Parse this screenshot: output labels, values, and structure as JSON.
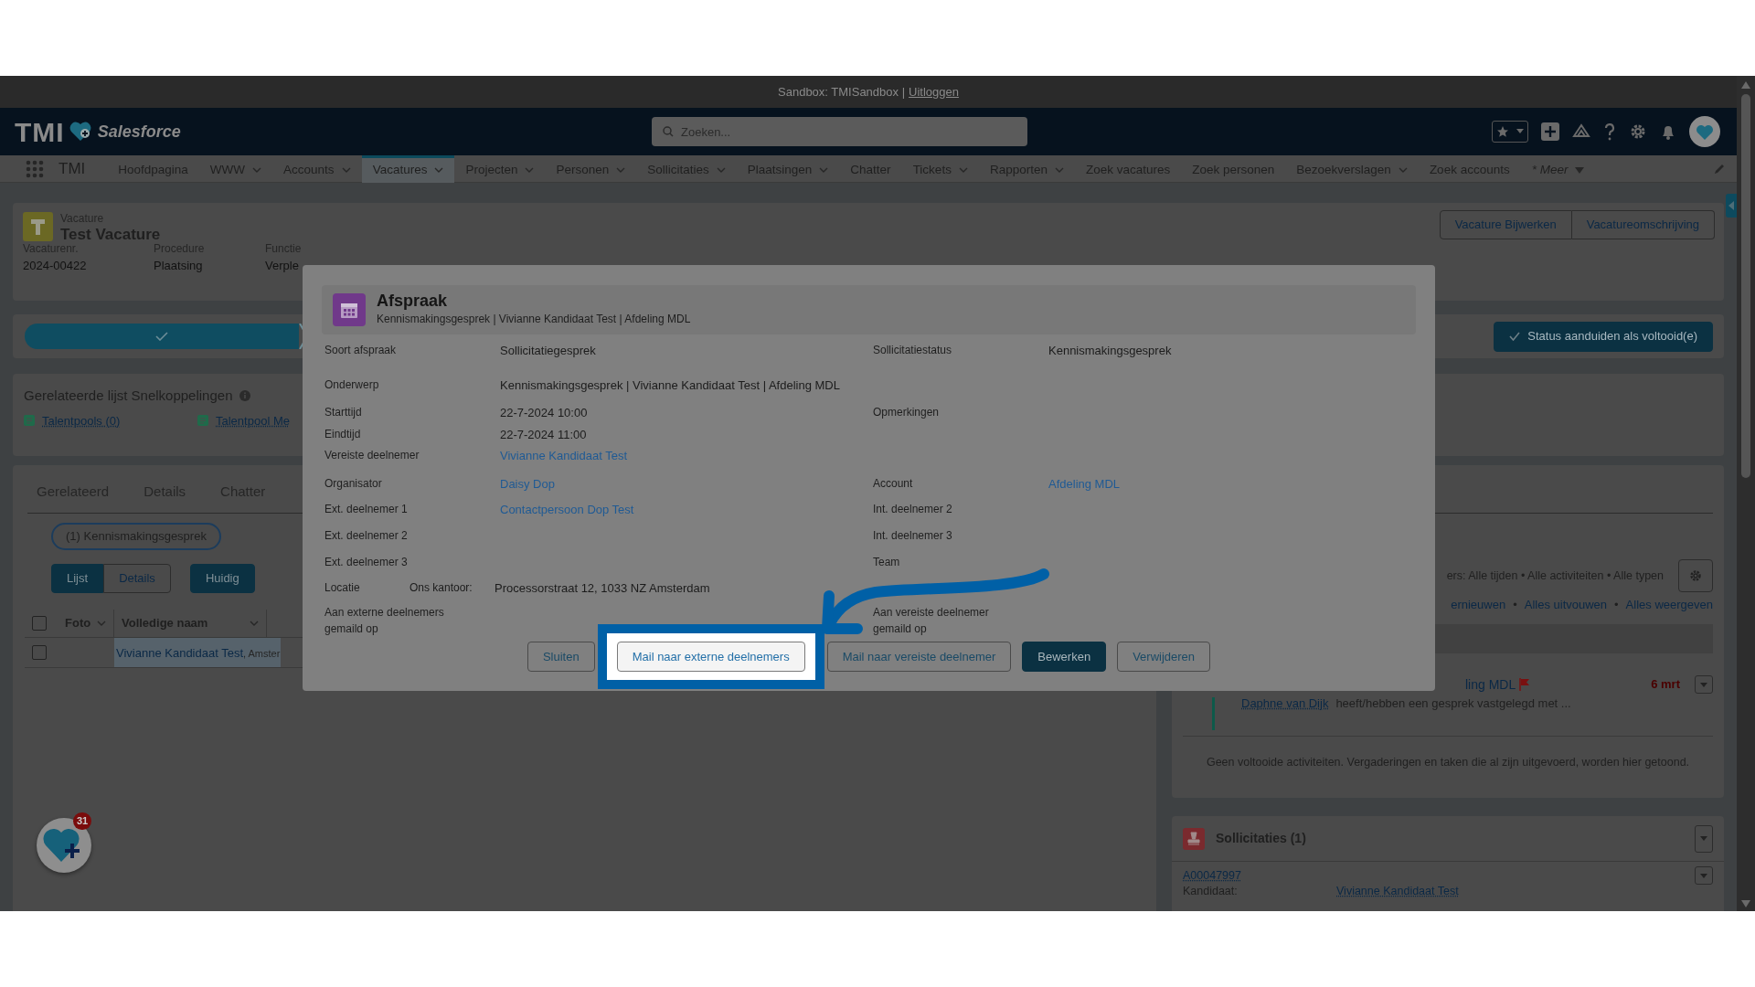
{
  "sandbox_bar": {
    "text": "Sandbox: TMISandbox |",
    "link": "Uitloggen"
  },
  "header": {
    "logo": "TMI",
    "brand": "Salesforce",
    "search": {
      "placeholder": "Zoeken..."
    }
  },
  "nav": {
    "app_name": "TMI",
    "items": [
      {
        "label": "Hoofdpagina",
        "kind": "plain",
        "selected": false
      },
      {
        "label": "WWW",
        "kind": "menu",
        "selected": false
      },
      {
        "label": "Accounts",
        "kind": "menu",
        "selected": false
      },
      {
        "label": "Vacatures",
        "kind": "menu",
        "selected": true
      },
      {
        "label": "Projecten",
        "kind": "menu",
        "selected": false
      },
      {
        "label": "Personen",
        "kind": "menu",
        "selected": false
      },
      {
        "label": "Sollicitaties",
        "kind": "menu",
        "selected": false
      },
      {
        "label": "Plaatsingen",
        "kind": "menu",
        "selected": false
      },
      {
        "label": "Chatter",
        "kind": "plain",
        "selected": false
      },
      {
        "label": "Tickets",
        "kind": "menu",
        "selected": false
      },
      {
        "label": "Rapporten",
        "kind": "menu",
        "selected": false
      },
      {
        "label": "Zoek vacatures",
        "kind": "plain",
        "selected": false
      },
      {
        "label": "Zoek personen",
        "kind": "plain",
        "selected": false
      },
      {
        "label": "Bezoekverslagen",
        "kind": "menu",
        "selected": false
      },
      {
        "label": "Zoek accounts",
        "kind": "plain",
        "selected": false
      },
      {
        "label": "* Meer",
        "kind": "more",
        "selected": false
      }
    ]
  },
  "record": {
    "object": "Vacature",
    "title": "Test Vacature",
    "fields": [
      {
        "label": "Vacaturenr.",
        "value": "2024-00422"
      },
      {
        "label": "Procedure",
        "value": "Plaatsing"
      },
      {
        "label": "Functie",
        "value": "Verple"
      }
    ],
    "actions": [
      "Vacature Bijwerken",
      "Vacatureomschrijving"
    ]
  },
  "path": {
    "action": "Status aanduiden als voltooid(e)"
  },
  "quick_links": {
    "title": "Gerelateerde lijst Snelkoppelingen",
    "links": [
      "Talentpools (0)",
      "Talentpool Me"
    ]
  },
  "tabs": [
    {
      "label": "Gerelateerd",
      "selected": false
    },
    {
      "label": "Details",
      "selected": false
    },
    {
      "label": "Chatter",
      "selected": false
    }
  ],
  "related": {
    "filter": "(1) Kennismakingsgesprek",
    "views": [
      {
        "label": "Lijst",
        "selected": true
      },
      {
        "label": "Details",
        "selected": false
      }
    ],
    "current": "Huidig",
    "select_all": false,
    "columns": [
      "Foto",
      "Volledige naam"
    ],
    "rows": [
      {
        "checked": false,
        "name": "Vivianne Kandidaat Test",
        "extra": ", Amster"
      }
    ]
  },
  "activity": {
    "filters": "ers: Alle tijden • Alle activiteiten • Alle typen",
    "links": [
      "ernieuwen",
      "Alles uitvouwen",
      "Alles weergeven"
    ],
    "separators": [
      "•",
      "•"
    ],
    "items": [
      {
        "subject": "ling MDL",
        "date": "6 mrt",
        "actor": "Daphne van Dijk",
        "text": "heeft/hebben een gesprek vastgelegd met ..."
      }
    ],
    "empty": "Geen voltooide activiteiten. Vergaderingen en taken die al zijn uitgevoerd, worden hier getoond."
  },
  "applications": {
    "title": "Sollicitaties (1)",
    "records": [
      {
        "id": "A00047997",
        "label": "Kandidaat:",
        "value": "Vivianne Kandidaat Test"
      }
    ]
  },
  "widget": {
    "badge": "31"
  },
  "modal": {
    "title": "Afspraak",
    "subtitle": "Kennismakingsgesprek | Vivianne Kandidaat Test | Afdeling MDL",
    "rows": [
      {
        "left": {
          "label": "Soort afspraak",
          "value": "Sollicitatiegesprek",
          "kind": "text"
        },
        "right": {
          "label": "Sollicitatiestatus",
          "value": "Kennismakingsgesprek",
          "kind": "text"
        }
      },
      {
        "left": {
          "label": "Onderwerp",
          "value": "Kennismakingsgesprek | Vivianne Kandidaat Test | Afdeling MDL",
          "kind": "text"
        }
      },
      {
        "left": {
          "label": "Starttijd",
          "value": "22-7-2024 10:00",
          "kind": "text"
        },
        "right": {
          "label": "Opmerkingen",
          "kind": "text"
        }
      },
      {
        "left": {
          "label": "Eindtijd",
          "value": "22-7-2024 11:00",
          "kind": "text"
        }
      },
      {
        "left": {
          "label": "Vereiste deelnemer",
          "value": "Vivianne Kandidaat Test",
          "kind": "link"
        }
      },
      {
        "left": {
          "label": "Organisator",
          "value": "Daisy Dop",
          "kind": "link"
        },
        "right": {
          "label": "Account",
          "value": "Afdeling MDL",
          "kind": "link"
        }
      },
      {
        "left": {
          "label": "Ext. deelnemer 1",
          "value": "Contactpersoon Dop Test",
          "kind": "link"
        },
        "right": {
          "label": "Int. deelnemer 2",
          "kind": "text"
        }
      },
      {
        "left": {
          "label": "Ext. deelnemer 2",
          "kind": "text"
        },
        "right": {
          "label": "Int. deelnemer 3",
          "kind": "text"
        }
      },
      {
        "left": {
          "label": "Ext. deelnemer 3",
          "kind": "text"
        },
        "right": {
          "label": "Team",
          "kind": "text"
        }
      },
      {
        "left": {
          "label": "Locatie",
          "kind": "location",
          "prefix": "Ons kantoor:",
          "value": "Processorstraat 12, 1033 NZ Amsterdam"
        }
      },
      {
        "left": {
          "label": "Aan externe deelnemers gemaild op",
          "kind": "text"
        },
        "right": {
          "label": "Aan vereiste deelnemer gemaild op",
          "kind": "text"
        }
      }
    ],
    "buttons": [
      {
        "label": "Sluiten",
        "kind": "neutral",
        "highlighted": false
      },
      {
        "label": "Mail naar externe deelnemers",
        "kind": "neutral",
        "highlighted": true
      },
      {
        "label": "Mail naar vereiste deelnemer",
        "kind": "neutral",
        "highlighted": false
      },
      {
        "label": "Bewerken",
        "kind": "brand",
        "highlighted": false
      },
      {
        "label": "Verwijderen",
        "kind": "neutral",
        "highlighted": false
      }
    ]
  }
}
